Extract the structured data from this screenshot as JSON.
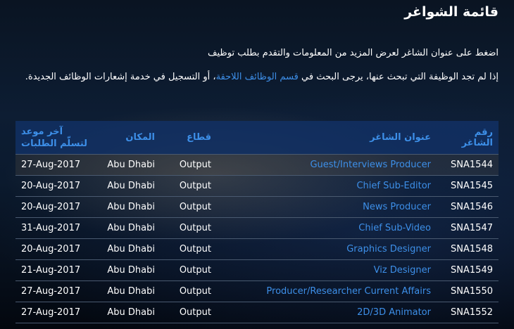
{
  "page": {
    "title": "قائمة الشواغر",
    "intro": "اضغط على عنوان الشاغر لعرض المزيد من المعلومات والتقدم بطلب توظيف",
    "note_before": "إذا لم تجد الوظيفة التي تبحث عنها، يرجى البحث في ",
    "note_link": "قسم الوظائف اللاحقة",
    "note_after": "، أو التسجيل في خدمة إشعارات الوظائف الجديدة."
  },
  "table": {
    "headers": {
      "ref": "رقم الشاغر",
      "title": "عنوان الشاغر",
      "sector": "قطاع",
      "location": "المكان",
      "deadline": "آخر موعد لتسلّم الطلبات"
    },
    "rows": [
      {
        "ref": "SNA1544",
        "title": "Guest/Interviews Producer",
        "sector": "Output",
        "location": "Abu Dhabi",
        "deadline": "27-Aug-2017"
      },
      {
        "ref": "SNA1545",
        "title": "Chief Sub-Editor",
        "sector": "Output",
        "location": "Abu Dhabi",
        "deadline": "20-Aug-2017"
      },
      {
        "ref": "SNA1546",
        "title": "News Producer",
        "sector": "Output",
        "location": "Abu Dhabi",
        "deadline": "20-Aug-2017"
      },
      {
        "ref": "SNA1547",
        "title": "Chief Sub-Video",
        "sector": "Output",
        "location": "Abu Dhabi",
        "deadline": "31-Aug-2017"
      },
      {
        "ref": "SNA1548",
        "title": "Graphics Designer",
        "sector": "Output",
        "location": "Abu Dhabi",
        "deadline": "20-Aug-2017"
      },
      {
        "ref": "SNA1549",
        "title": "Viz Designer",
        "sector": "Output",
        "location": "Abu Dhabi",
        "deadline": "21-Aug-2017"
      },
      {
        "ref": "SNA1550",
        "title": "Producer/Researcher Current Affairs",
        "sector": "Output",
        "location": "Abu Dhabi",
        "deadline": "27-Aug-2017"
      },
      {
        "ref": "SNA1552",
        "title": "2D/3D Animator",
        "sector": "Output",
        "location": "Abu Dhabi",
        "deadline": "27-Aug-2017"
      }
    ]
  },
  "colors": {
    "link": "#3d8fe8",
    "header_bg": "#123064",
    "row_divider": "#4a5a70"
  }
}
